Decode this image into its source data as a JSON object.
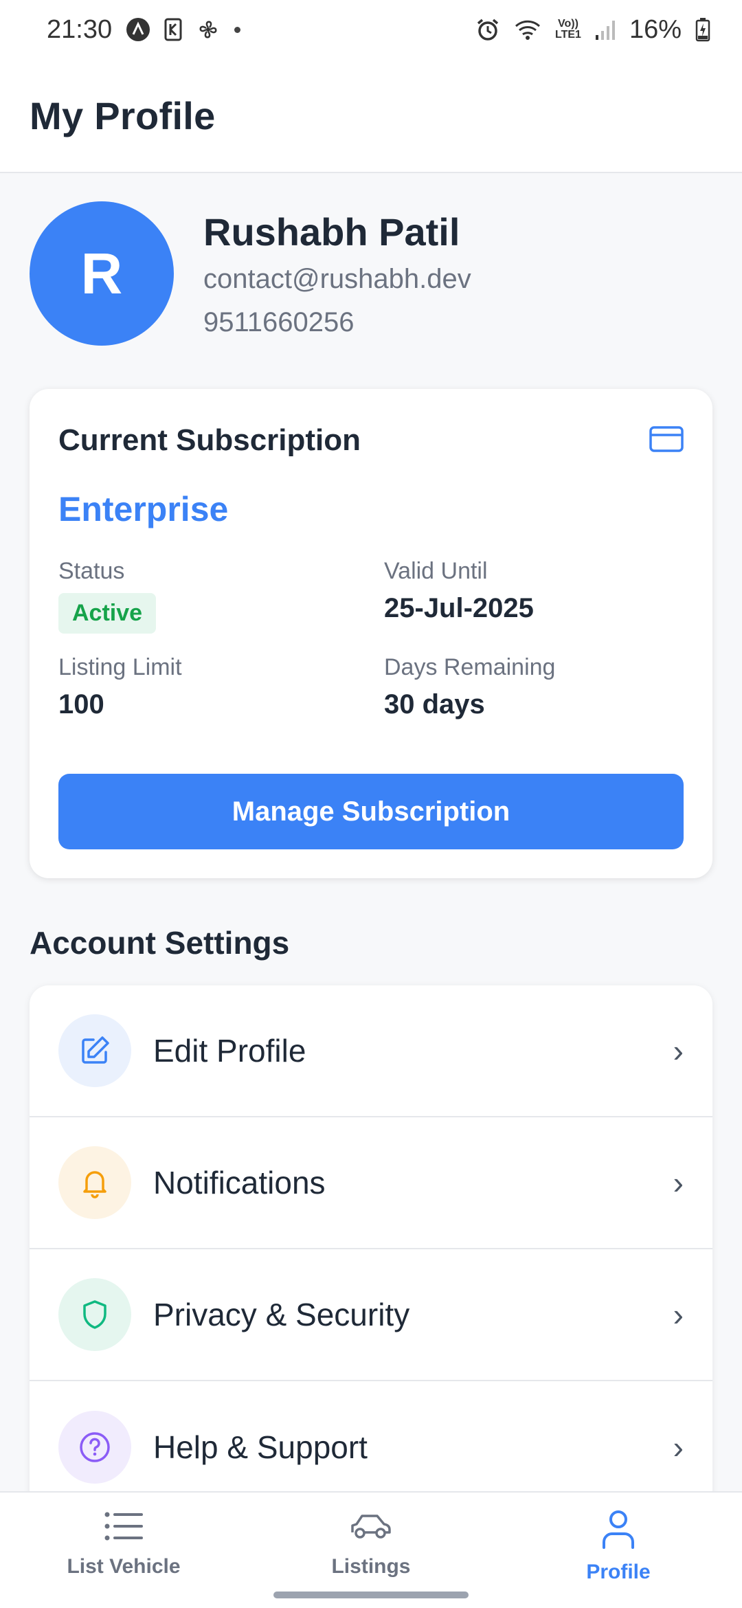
{
  "status_bar": {
    "time": "21:30",
    "battery": "16%",
    "network": "LTE1"
  },
  "header": {
    "title": "My Profile"
  },
  "profile": {
    "initial": "R",
    "name": "Rushabh Patil",
    "email": "contact@rushabh.dev",
    "phone": "9511660256"
  },
  "subscription": {
    "title": "Current Subscription",
    "plan": "Enterprise",
    "status_label": "Status",
    "status_value": "Active",
    "valid_label": "Valid Until",
    "valid_value": "25-Jul-2025",
    "limit_label": "Listing Limit",
    "limit_value": "100",
    "days_label": "Days Remaining",
    "days_value": "30 days",
    "button_label": "Manage Subscription"
  },
  "settings": {
    "title": "Account Settings",
    "items": [
      {
        "label": "Edit Profile",
        "icon": "edit-icon",
        "color": "#3b82f6"
      },
      {
        "label": "Notifications",
        "icon": "bell-icon",
        "color": "#f59e0b"
      },
      {
        "label": "Privacy & Security",
        "icon": "shield-icon",
        "color": "#10b981"
      },
      {
        "label": "Help & Support",
        "icon": "help-icon",
        "color": "#8b5cf6"
      }
    ],
    "chevron": "›"
  },
  "bottom_nav": {
    "items": [
      {
        "label": "List Vehicle",
        "icon": "list-icon"
      },
      {
        "label": "Listings",
        "icon": "car-icon"
      },
      {
        "label": "Profile",
        "icon": "user-icon",
        "active": true
      }
    ]
  },
  "colors": {
    "accent": "#3b82f6",
    "success": "#16a34a",
    "warning": "#f59e0b",
    "purple": "#8b5cf6"
  }
}
